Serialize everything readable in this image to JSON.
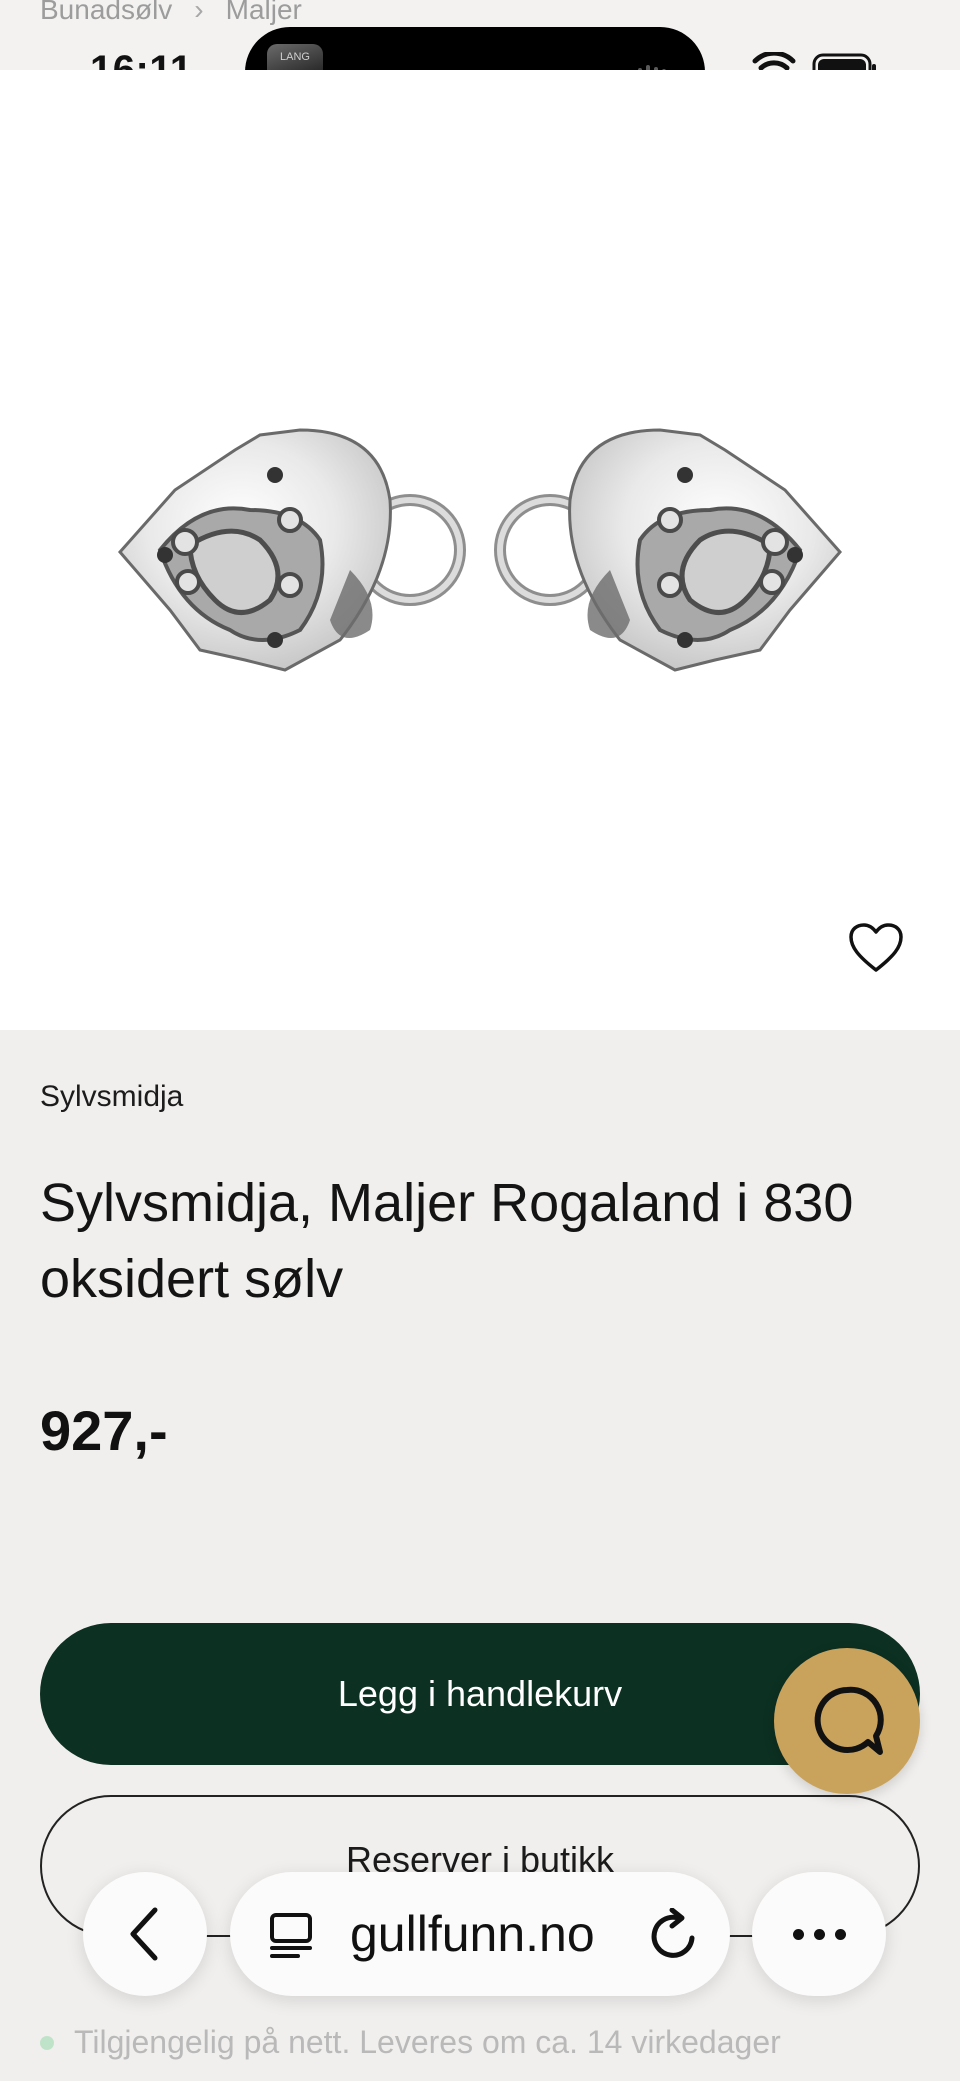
{
  "breadcrumb": {
    "items": [
      "Bunadsølv",
      "Maljer"
    ],
    "separator": "›"
  },
  "status_bar": {
    "time": "16:11",
    "island_thumb_text": "LANG"
  },
  "product": {
    "brand": "Sylvsmidja",
    "title": "Sylvsmidja, Maljer Rogaland i 830 oksidert sølv",
    "price": "927,-",
    "image_alt": "Maljer Rogaland heart-shaped silver clasps"
  },
  "actions": {
    "add_to_cart": "Legg i handlekurv",
    "reserve": "Reserver i butikk"
  },
  "availability": {
    "text": "Tilgjengelig på nett. Leveres om ca. 14 virkedager",
    "dot_color": "#bfe3c9"
  },
  "browser": {
    "url": "gullfunn.no"
  },
  "colors": {
    "primary": "#0c3022",
    "chat": "#c9a25c",
    "background": "#f1efed"
  },
  "icons": [
    "wifi-icon",
    "battery-icon",
    "heart-icon",
    "chat-icon",
    "back-icon",
    "page-icon",
    "reload-icon",
    "more-icon"
  ]
}
